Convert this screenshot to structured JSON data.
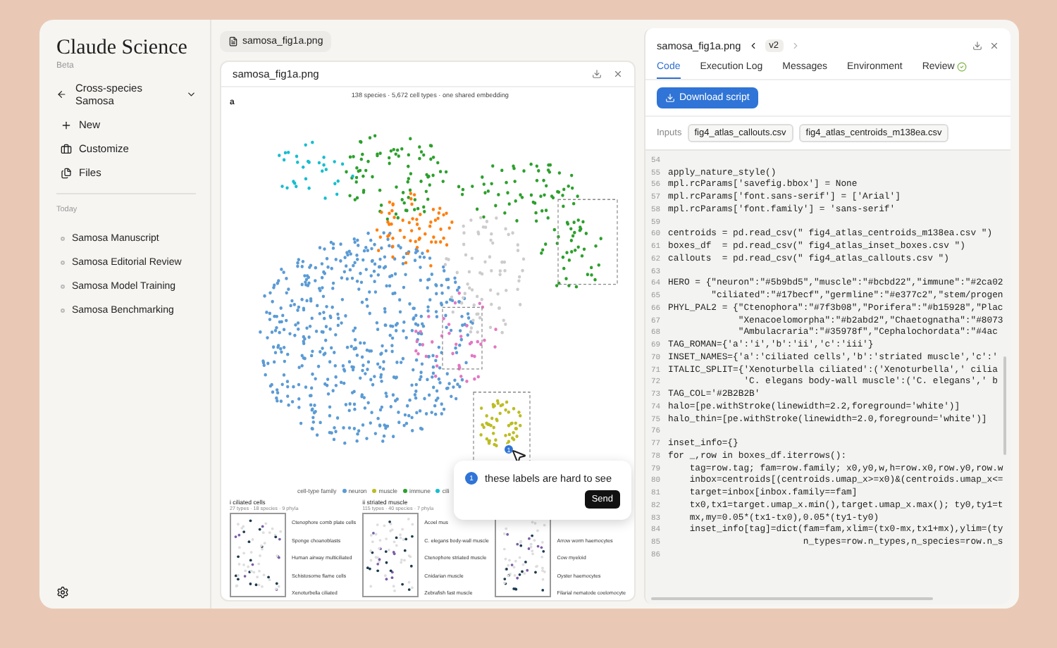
{
  "sidebar": {
    "brand": "Claude Science",
    "badge": "Beta",
    "project": "Cross-species Samosa",
    "actions": [
      {
        "kind": "new",
        "label": "New"
      },
      {
        "kind": "customize",
        "label": "Customize"
      },
      {
        "kind": "files",
        "label": "Files"
      }
    ],
    "section": "Today",
    "chats": [
      "Samosa Manuscript",
      "Samosa Editorial Review",
      "Samosa Model Training",
      "Samosa Benchmarking"
    ]
  },
  "viewer": {
    "tab": "samosa_fig1a.png",
    "card_title": "samosa_fig1a.png",
    "figure": {
      "panel": "a",
      "caption": "138 species · 5,672 cell types · one shared embedding",
      "legend_title": "cell-type family",
      "legend": [
        {
          "label": "neuron",
          "color": "#5b9bd5"
        },
        {
          "label": "muscle",
          "color": "#bcbd22"
        },
        {
          "label": "immune",
          "color": "#2ca02c"
        },
        {
          "label": "cili",
          "color": "#17becf"
        }
      ],
      "insets": [
        {
          "numeral": "i",
          "title": "ciliated cells",
          "subtitle": "27 types · 18 species · 9 phyla",
          "callouts": [
            "Ctenophore comb plate cells",
            "Sponge choanoblasts",
            "Human airway multiciliated",
            "Schistosome flame cells",
            "Xenoturbella ciliated"
          ]
        },
        {
          "numeral": "ii",
          "title": "striated muscle",
          "subtitle": "115 types · 40 species · 7 phyla",
          "callouts": [
            "Acoel mus",
            "C. elegans body-wall muscle",
            "Ctenophore striated muscle",
            "Cnidarian muscle",
            "Zebrafish fast muscle"
          ]
        },
        {
          "callouts": [
            "Arrow worm haemocytes",
            "Cow myeloid",
            "Oyster haemocytes",
            "Filarial nematode coelomocyte"
          ]
        }
      ]
    },
    "pin": "1",
    "comment": {
      "number": "1",
      "text": "these labels are hard to see",
      "button": "Send"
    }
  },
  "editor": {
    "title": "samosa_fig1a.png",
    "version": "v2",
    "tabs": [
      {
        "label": "Code",
        "selected": true,
        "verified": false
      },
      {
        "label": "Execution Log",
        "selected": false,
        "verified": false
      },
      {
        "label": "Messages",
        "selected": false,
        "verified": false
      },
      {
        "label": "Environment",
        "selected": false,
        "verified": false
      },
      {
        "label": "Review",
        "selected": false,
        "verified": true
      }
    ],
    "download": "Download script",
    "inputs_label": "Inputs",
    "inputs": [
      "fig4_atlas_callouts.csv",
      "fig4_atlas_centroids_m138ea.csv"
    ],
    "lines": [
      {
        "number": "54"
      },
      {
        "number": "55",
        "code": "apply_nature_style()"
      },
      {
        "number": "56",
        "code": "mpl.rcParams['savefig.bbox'] = None"
      },
      {
        "number": "57",
        "code": "mpl.rcParams['font.sans-serif'] = ['Arial']"
      },
      {
        "number": "58",
        "code": "mpl.rcParams['font.family'] = 'sans-serif'"
      },
      {
        "number": "59"
      },
      {
        "number": "60",
        "code": "centroids = pd.read_csv(\" fig4_atlas_centroids_m138ea.csv \")"
      },
      {
        "number": "61",
        "code": "boxes_df  = pd.read_csv(\" fig4_atlas_inset_boxes.csv \")"
      },
      {
        "number": "62",
        "code": "callouts  = pd.read_csv(\" fig4_atlas_callouts.csv \")"
      },
      {
        "number": "63"
      },
      {
        "number": "64",
        "code": "HERO = {\"neuron\":\"#5b9bd5\",\"muscle\":\"#bcbd22\",\"immune\":\"#2ca02"
      },
      {
        "number": "65",
        "code": "        \"ciliated\":\"#17becf\",\"germline\":\"#e377c2\",\"stem/progen"
      },
      {
        "number": "66",
        "code": "PHYL_PAL2 = {\"Ctenophora\":\"#7f3b08\",\"Porifera\":\"#b15928\",\"Plac"
      },
      {
        "number": "67",
        "code": "             \"Xenacoelomorpha\":\"#b2abd2\",\"Chaetognatha\":\"#8073"
      },
      {
        "number": "68",
        "code": "             \"Ambulacraria\":\"#35978f\",\"Cephalochordata\":\"#4ac"
      },
      {
        "number": "69",
        "code": "TAG_ROMAN={'a':'i','b':'ii','c':'iii'}"
      },
      {
        "number": "70",
        "code": "INSET_NAMES={'a':'ciliated cells','b':'striated muscle','c':'"
      },
      {
        "number": "71",
        "code": "ITALIC_SPLIT={'Xenoturbella ciliated':('Xenoturbella',' cilia"
      },
      {
        "number": "72",
        "code": "              'C. elegans body-wall muscle':('C. elegans',' b"
      },
      {
        "number": "73",
        "code": "TAG_COL='#2B2B2B'"
      },
      {
        "number": "74",
        "code": "halo=[pe.withStroke(linewidth=2.2,foreground='white')]"
      },
      {
        "number": "75",
        "code": "halo_thin=[pe.withStroke(linewidth=2.0,foreground='white')]"
      },
      {
        "number": "76"
      },
      {
        "number": "77",
        "code": "inset_info={}"
      },
      {
        "number": "78",
        "code": "for _,row in boxes_df.iterrows():"
      },
      {
        "number": "79",
        "code": "    tag=row.tag; fam=row.family; x0,y0,w,h=row.x0,row.y0,row.w"
      },
      {
        "number": "80",
        "code": "    inbox=centroids[(centroids.umap_x>=x0)&(centroids.umap_x<="
      },
      {
        "number": "81",
        "code": "    target=inbox[inbox.family==fam]"
      },
      {
        "number": "82",
        "code": "    tx0,tx1=target.umap_x.min(),target.umap_x.max(); ty0,ty1=t"
      },
      {
        "number": "83",
        "code": "    mx,my=0.05*(tx1-tx0),0.05*(ty1-ty0)"
      },
      {
        "number": "84",
        "code": "    inset_info[tag]=dict(fam=fam,xlim=(tx0-mx,tx1+mx),ylim=(ty"
      },
      {
        "number": "85",
        "code": "                         n_types=row.n_types,n_species=row.n_s"
      },
      {
        "number": "86"
      }
    ]
  }
}
